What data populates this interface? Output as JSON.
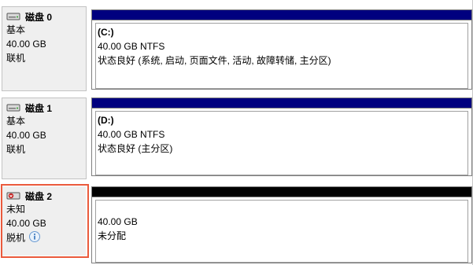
{
  "disks": [
    {
      "name": "磁盘 0",
      "type": "基本",
      "size": "40.00 GB",
      "status": "联机",
      "icon": "disk-icon",
      "bar_color": "#00007f",
      "volume": {
        "label": "(C:)",
        "detail": "40.00 GB NTFS",
        "status": "状态良好 (系统, 启动, 页面文件, 活动, 故障转储, 主分区)"
      }
    },
    {
      "name": "磁盘 1",
      "type": "基本",
      "size": "40.00 GB",
      "status": "联机",
      "icon": "disk-icon",
      "bar_color": "#00007f",
      "volume": {
        "label": "(D:)",
        "detail": "40.00 GB NTFS",
        "status": "状态良好 (主分区)"
      }
    },
    {
      "name": "磁盘 2",
      "type": "未知",
      "size": "40.00 GB",
      "status": "脱机",
      "icon": "offline-disk-icon",
      "status_icon": "info-icon",
      "bar_color": "#000000",
      "volume": {
        "detail": "40.00 GB",
        "status": "未分配"
      }
    }
  ],
  "highlight_color": "#ea5a3c"
}
